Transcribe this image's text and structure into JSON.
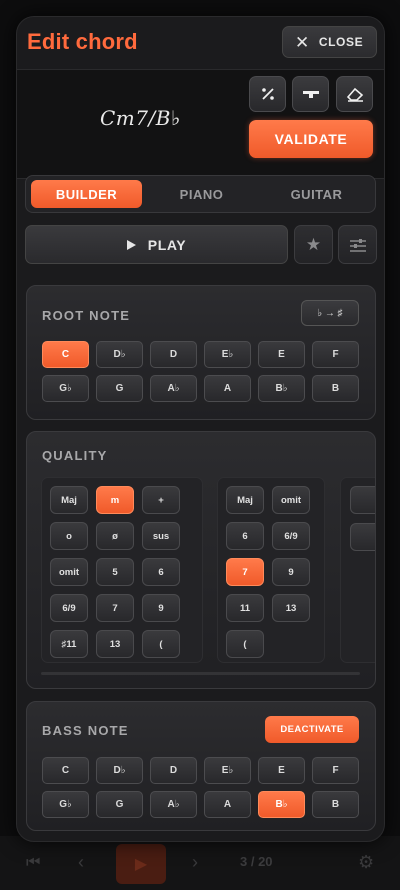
{
  "modal": {
    "title": "Edit chord",
    "close_label": "CLOSE",
    "chord_name": "Cm7/B♭",
    "tools": [
      {
        "icon": "percent-icon",
        "glyph": "∕"
      },
      {
        "icon": "minus-icon",
        "glyph": "‒"
      },
      {
        "icon": "eraser-icon",
        "glyph": "⌫"
      }
    ],
    "validate_label": "VALIDATE",
    "tabs": [
      "BUILDER",
      "PIANO",
      "GUITAR"
    ],
    "active_tab": "BUILDER",
    "play_label": "PLAY"
  },
  "root": {
    "title": "ROOT NOTE",
    "toggle_label": "♭ → ♯",
    "notes": [
      "C",
      "D♭",
      "D",
      "E♭",
      "E",
      "F",
      "G♭",
      "G",
      "A♭",
      "A",
      "B♭",
      "B"
    ],
    "selected": "C"
  },
  "quality": {
    "title": "QUALITY",
    "col1": [
      "Maj",
      "m",
      "+",
      "o",
      "ø",
      "sus",
      "omit",
      "5",
      "6",
      "6/9",
      "7",
      "9",
      "♯11",
      "13",
      "("
    ],
    "col1_selected": "m",
    "col2": [
      "Maj",
      "omit",
      "6",
      "6/9",
      "7",
      "9",
      "11",
      "13",
      "("
    ],
    "col2_selected": "7"
  },
  "bass": {
    "title": "BASS NOTE",
    "deactivate_label": "DEACTIVATE",
    "notes": [
      "C",
      "D♭",
      "D",
      "E♭",
      "E",
      "F",
      "G♭",
      "G",
      "A♭",
      "A",
      "B♭",
      "B"
    ],
    "selected": "B♭"
  },
  "bottom_bar": {
    "counter": "3 / 20"
  },
  "colors": {
    "accent": "#ff6a3d",
    "panel": "#2a2a2d"
  }
}
